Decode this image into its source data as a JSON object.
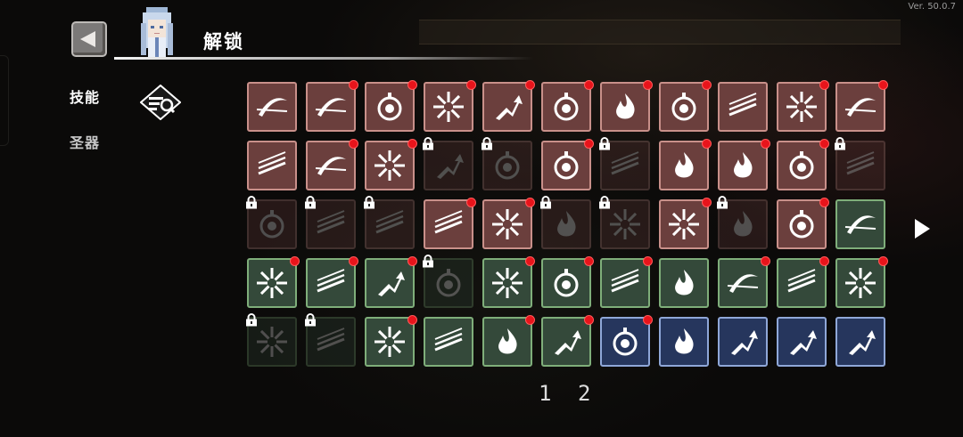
{
  "version": "Ver. 50.0.7",
  "header": {
    "title": "解锁"
  },
  "nav": {
    "skills_label": "技能",
    "relics_label": "圣器"
  },
  "pagination": {
    "pages": [
      "1",
      "2"
    ]
  },
  "colors": {
    "red_tile": "#6b3f3d",
    "red_border": "#c9908a",
    "green_tile": "#34493a",
    "green_border": "#7fae7a",
    "blue_tile": "#26365d",
    "blue_border": "#8fa7d8",
    "new_dot": "#e8141b"
  },
  "grid": {
    "rows": [
      [
        {
          "tier": "red",
          "icon": "slash-arc-icon",
          "locked": false,
          "new": false
        },
        {
          "tier": "red",
          "icon": "crescent-slash-icon",
          "locked": false,
          "new": true
        },
        {
          "tier": "red",
          "icon": "shield-crest-icon",
          "locked": false,
          "new": true
        },
        {
          "tier": "red",
          "icon": "burst-star-icon",
          "locked": false,
          "new": true
        },
        {
          "tier": "red",
          "icon": "arrow-upgrade-icon",
          "locked": false,
          "new": true
        },
        {
          "tier": "red",
          "icon": "frost-orb-icon",
          "locked": false,
          "new": true
        },
        {
          "tier": "red",
          "icon": "flame-orb-icon",
          "locked": false,
          "new": true
        },
        {
          "tier": "red",
          "icon": "lightning-ring-icon",
          "locked": false,
          "new": true
        },
        {
          "tier": "red",
          "icon": "triple-arrows-icon",
          "locked": false,
          "new": false
        },
        {
          "tier": "red",
          "icon": "biohazard-burst-icon",
          "locked": false,
          "new": true
        },
        {
          "tier": "red",
          "icon": "moon-claw-icon",
          "locked": false,
          "new": true
        }
      ],
      [
        {
          "tier": "red",
          "icon": "wind-slash-icon",
          "locked": false,
          "new": false
        },
        {
          "tier": "red",
          "icon": "feather-dart-icon",
          "locked": false,
          "new": true
        },
        {
          "tier": "red",
          "icon": "crosshair-spark-icon",
          "locked": false,
          "new": true
        },
        {
          "tier": "red",
          "icon": "frost-arrow-icon",
          "locked": true,
          "new": false
        },
        {
          "tier": "red",
          "icon": "vortex-icon",
          "locked": true,
          "new": false
        },
        {
          "tier": "red",
          "icon": "target-orb-icon",
          "locked": false,
          "new": true
        },
        {
          "tier": "red",
          "icon": "arrow-volley-icon",
          "locked": true,
          "new": false
        },
        {
          "tier": "red",
          "icon": "dragon-cloud-icon",
          "locked": false,
          "new": true
        },
        {
          "tier": "red",
          "icon": "gauntlet-icon",
          "locked": false,
          "new": true
        },
        {
          "tier": "red",
          "icon": "shockwave-ring-icon",
          "locked": false,
          "new": true
        },
        {
          "tier": "red",
          "icon": "spear-throw-icon",
          "locked": true,
          "new": false
        }
      ],
      [
        {
          "tier": "red",
          "icon": "thunder-orb-icon",
          "locked": true,
          "new": false
        },
        {
          "tier": "red",
          "icon": "claw-strike-icon",
          "locked": true,
          "new": false
        },
        {
          "tier": "red",
          "icon": "spark-trail-icon",
          "locked": true,
          "new": false
        },
        {
          "tier": "red",
          "icon": "blade-cross-icon",
          "locked": false,
          "new": true
        },
        {
          "tier": "red",
          "icon": "pulse-wave-icon",
          "locked": false,
          "new": true
        },
        {
          "tier": "red",
          "icon": "flame-burst-icon",
          "locked": true,
          "new": false
        },
        {
          "tier": "red",
          "icon": "spike-field-icon",
          "locked": true,
          "new": false
        },
        {
          "tier": "red",
          "icon": "fanged-maw-icon",
          "locked": false,
          "new": true
        },
        {
          "tier": "red",
          "icon": "shadow-flame-icon",
          "locked": true,
          "new": false
        },
        {
          "tier": "red",
          "icon": "sword-orb-icon",
          "locked": false,
          "new": true
        },
        {
          "tier": "green",
          "icon": "ground-slash-icon",
          "locked": false,
          "new": false
        }
      ],
      [
        {
          "tier": "green",
          "icon": "dash-stars-icon",
          "locked": false,
          "new": true
        },
        {
          "tier": "green",
          "icon": "lightning-bolt-icon",
          "locked": false,
          "new": true
        },
        {
          "tier": "green",
          "icon": "fist-slam-icon",
          "locked": false,
          "new": true
        },
        {
          "tier": "green",
          "icon": "orb-burst-icon",
          "locked": true,
          "new": false
        },
        {
          "tier": "green",
          "icon": "skull-shatter-icon",
          "locked": false,
          "new": true
        },
        {
          "tier": "green",
          "icon": "biohazard-icon",
          "locked": false,
          "new": true
        },
        {
          "tier": "green",
          "icon": "sword-beam-icon",
          "locked": false,
          "new": true
        },
        {
          "tier": "green",
          "icon": "water-spirit-icon",
          "locked": false,
          "new": false
        },
        {
          "tier": "green",
          "icon": "crescent-hook-icon",
          "locked": false,
          "new": true
        },
        {
          "tier": "green",
          "icon": "falling-daggers-icon",
          "locked": false,
          "new": true
        },
        {
          "tier": "green",
          "icon": "crack-web-icon",
          "locked": false,
          "new": true
        }
      ],
      [
        {
          "tier": "green",
          "icon": "dust-cloud-icon",
          "locked": true,
          "new": false
        },
        {
          "tier": "green",
          "icon": "feather-dash-icon",
          "locked": true,
          "new": false
        },
        {
          "tier": "green",
          "icon": "spinning-blades-icon",
          "locked": false,
          "new": true
        },
        {
          "tier": "green",
          "icon": "sonic-slash-icon",
          "locked": false,
          "new": false
        },
        {
          "tier": "green",
          "icon": "water-drop-icon",
          "locked": false,
          "new": true
        },
        {
          "tier": "green",
          "icon": "bone-armor-icon",
          "locked": false,
          "new": true
        },
        {
          "tier": "blue",
          "icon": "soccer-ball-icon",
          "locked": false,
          "new": true
        },
        {
          "tier": "blue",
          "icon": "ghost-spirit-icon",
          "locked": false,
          "new": false
        },
        {
          "tier": "blue",
          "icon": "hourglass-up-icon",
          "locked": false,
          "new": false
        },
        {
          "tier": "blue",
          "icon": "stairs-up-icon",
          "locked": false,
          "new": false
        },
        {
          "tier": "blue",
          "icon": "boot-up-icon",
          "locked": false,
          "new": false
        }
      ]
    ]
  }
}
